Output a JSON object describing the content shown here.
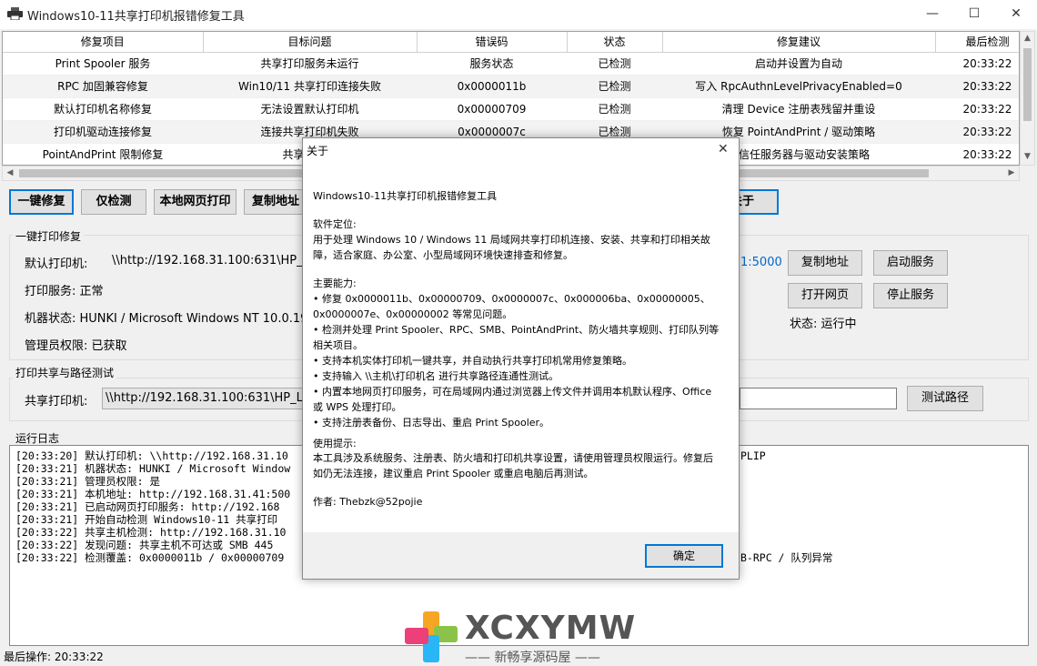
{
  "window": {
    "title": "Windows10-11共享打印机报错修复工具",
    "minimize": "—",
    "maximize": "☐",
    "close": "✕"
  },
  "table": {
    "columns": [
      "修复项目",
      "目标问题",
      "错误码",
      "状态",
      "修复建议",
      "最后检测"
    ],
    "rows": [
      [
        "Print Spooler 服务",
        "共享打印服务未运行",
        "服务状态",
        "已检测",
        "启动并设置为自动",
        "20:33:22"
      ],
      [
        "RPC 加固兼容修复",
        "Win10/11 共享打印连接失败",
        "0x0000011b",
        "已检测",
        "写入 RpcAuthnLevelPrivacyEnabled=0",
        "20:33:22"
      ],
      [
        "默认打印机名称修复",
        "无法设置默认打印机",
        "0x00000709",
        "已检测",
        "清理 Device 注册表残留并重设",
        "20:33:22"
      ],
      [
        "打印机驱动连接修复",
        "连接共享打印机失败",
        "0x0000007c",
        "已检测",
        "恢复 PointAndPrint / 驱动策略",
        "20:33:22"
      ],
      [
        "PointAndPrint 限制修复",
        "共享打印机",
        "",
        "",
        "受信任服务器与驱动安装策略",
        "20:33:22"
      ]
    ]
  },
  "toolbar": {
    "one_click_fix": "一键修复",
    "detect_only": "仅检测",
    "local_web_print": "本地网页打印",
    "copy_address": "复制地址",
    "about": "关于"
  },
  "print_repair": {
    "group_title": "一键打印修复",
    "default_printer_label": "默认打印机:",
    "default_printer_value": "\\\\http://192.168.31.100:631\\HP_Lase",
    "print_service": "打印服务: 正常",
    "machine_state": "机器状态: HUNKI / Microsoft Windows NT 10.0.19043",
    "admin_rights": "管理员权限: 已获取",
    "web_address_tail": "1:5000",
    "copy_address_btn": "复制地址",
    "start_service_btn": "启动服务",
    "open_web_btn": "打开网页",
    "stop_service_btn": "停止服务",
    "service_status": "状态: 运行中"
  },
  "share_test": {
    "group_title": "打印共享与路径测试",
    "shared_printer_label": "共享打印机:",
    "shared_printer_value": "\\\\http://192.168.31.100:631\\HP_La",
    "path_input": "",
    "test_path_btn": "测试路径"
  },
  "log": {
    "group_title": "运行日志",
    "lines": [
      "[20:33:20] 默认打印机: \\\\http://192.168.31.10",
      "[20:33:21] 机器状态: HUNKI / Microsoft Window",
      "[20:33:21] 管理员权限: 是",
      "[20:33:21] 本机地址: http://192.168.31.41:500",
      "[20:33:21] 已启动网页打印服务: http://192.168",
      "[20:33:21] 开始自动检测 Windows10-11 共享打印",
      "[20:33:22] 共享主机检测: http://192.168.31.10",
      "[20:33:22] 发现问题: 共享主机不可达或 SMB 445",
      "[20:33:22] 检测覆盖: 0x0000011b / 0x00000709"
    ],
    "tail_1": "PLIP",
    "tail_8": "B-RPC / 队列异常"
  },
  "status_bar": {
    "last_operation": "最后操作: 20:33:22"
  },
  "dialog": {
    "title": "关于",
    "app_name": "Windows10-11共享打印机报错修复工具",
    "positioning_title": "软件定位:",
    "positioning_text": "用于处理 Windows 10 / Windows 11 局域网共享打印机连接、安装、共享和打印相关故障，适合家庭、办公室、小型局域网环境快速排查和修复。",
    "abilities_title": "主要能力:",
    "abilities": [
      "• 修复 0x0000011b、0x00000709、0x0000007c、0x000006ba、0x00000005、0x0000007e、0x00000002 等常见问题。",
      "• 检测并处理 Print Spooler、RPC、SMB、PointAndPrint、防火墙共享规则、打印队列等相关项目。",
      "• 支持本机实体打印机一键共享，并自动执行共享打印机常用修复策略。",
      "• 支持输入 \\\\主机\\打印机名 进行共享路径连通性测试。",
      "• 内置本地网页打印服务，可在局域网内通过浏览器上传文件并调用本机默认程序、Office 或 WPS 处理打印。",
      "• 支持注册表备份、日志导出、重启 Print Spooler。"
    ],
    "usage_title": "使用提示:",
    "usage_text": "本工具涉及系统服务、注册表、防火墙和打印机共享设置，请使用管理员权限运行。修复后如仍无法连接，建议重启 Print Spooler 或重启电脑后再测试。",
    "author": "作者: Thebzk@52pojie",
    "ok_button": "确定",
    "close_glyph": "✕"
  },
  "watermark": {
    "brand": "XCXYMW",
    "tagline": "—— 新畅享源码屋 ——"
  },
  "colors": {
    "accent": "#0078d7",
    "link": "#0066cc"
  }
}
